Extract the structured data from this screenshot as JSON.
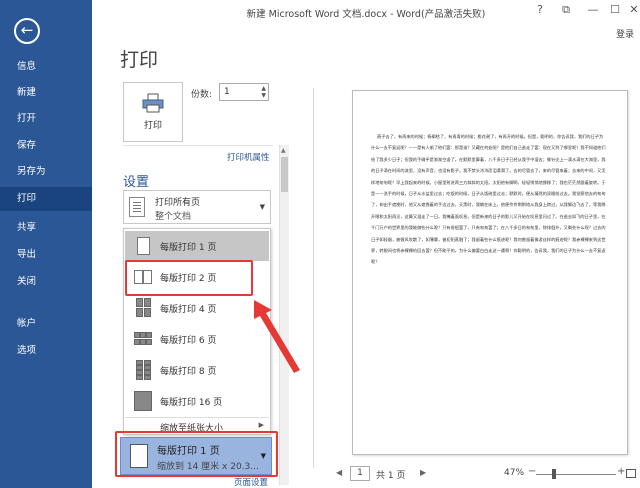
{
  "window": {
    "title": "新建 Microsoft Word 文档.docx - Word(产品激活失败)",
    "controls": [
      "?",
      "⧉",
      "—",
      "☐",
      "✕"
    ],
    "login_label": "登录"
  },
  "sidebar": {
    "back_icon": "back-arrow-icon",
    "items": [
      {
        "label": "信息"
      },
      {
        "label": "新建"
      },
      {
        "label": "打开"
      },
      {
        "label": "保存"
      },
      {
        "label": "另存为"
      },
      {
        "label": "打印",
        "active": true
      },
      {
        "label": "共享"
      },
      {
        "label": "导出"
      },
      {
        "label": "关闭"
      },
      {
        "label": "帐户"
      },
      {
        "label": "选项"
      }
    ],
    "bg_color": "#2b5797"
  },
  "print": {
    "heading": "打印",
    "button_label": "打印",
    "copies_label": "份数:",
    "copies_value": "1",
    "printer_properties": "打印机属性",
    "settings_heading": "设置",
    "page_setup": "页面设置"
  },
  "pages_dropdown": {
    "line1": "打印所有页",
    "line2": "整个文档"
  },
  "pages_per_sheet_menu": {
    "items": [
      {
        "label": "每版打印 1 页",
        "selected": true
      },
      {
        "label": "每版打印 2 页",
        "highlighted": true
      },
      {
        "label": "每版打印 4 页"
      },
      {
        "label": "每版打印 6 页"
      },
      {
        "label": "每版打印 8 页"
      },
      {
        "label": "每版打印 16 页"
      }
    ],
    "scale_label": "缩放至纸张大小"
  },
  "selected_dropdown": {
    "line1": "每版打印 1 页",
    "line2": "缩放到 14 厘米 x 20.3..."
  },
  "preview": {
    "paragraph": "燕子去了，有再来的时候；杨柳枯了，有再青的时候；桃花谢了，有再开的时候。但是，聪明的，你告诉我，我们的日子为什么一去不复返呢？——是有人偷了他们罢：那是谁？又藏在何处呢？是他们自己逃走了罢：现在又到了哪里呢？我不知道他们给了我多少日子；但我的手确乎是渐渐空虚了。在默默里算着，八千多日子已经从我手中溜去；像针尖上一滴水滴在大海里，我的日子滴在时间的流里，没有声音，也没有影子。我不禁头涔涔而泪潸潸了。去的尽管去了，来的尽管来着；去来的中间，又怎样地匆匆呢？早上我起来的时候，小屋里射进两三方斜斜的太阳。太阳他有脚啊，轻轻悄悄地挪移了；我也茫茫然跟着旋转。于是——洗手的时候，日子从水盆里过去；吃饭的时候，日子从饭碗里过去；默默时，便从凝然的双眼前过去。我觉察他去的匆匆了，伸出手遮挽时，他又从遮挽着的手边过去，天黑时，我躺在床上，他便伶伶俐俐地从我身上跨过，从我脚边飞去了。等我睁开眼和太阳再见，这算又溜走了一日。我掩着面叹息。但是新来的日子的影儿又开始在叹息里闪过了。在逃去如飞的日子里，在千门万户的世界里的我能做些什么呢？只有徘徊罢了，只有匆匆罢了；在八千多日的匆匆里，除徘徊外，又剩些什么呢？过去的日子如轻烟，被微风吹散了，如薄雾，被初阳蒸融了；我留着些什么痕迹呢？我何曾留着像游丝样的痕迹呢？我赤裸裸来到这世界，转眼间也将赤裸裸的回去罢？但不能平的，为什么偏要白白走这一遭啊？你聪明的，告诉我，我们的日子为什么一去不复返呢？"
  },
  "statusbar": {
    "page_current": "1",
    "page_of": "共 1 页",
    "zoom": "47%",
    "zoom_percent": 47
  },
  "colors": {
    "accent": "#2b5797",
    "highlight_red": "#e53935",
    "selected_dropdown_bg": "#99b4de"
  }
}
